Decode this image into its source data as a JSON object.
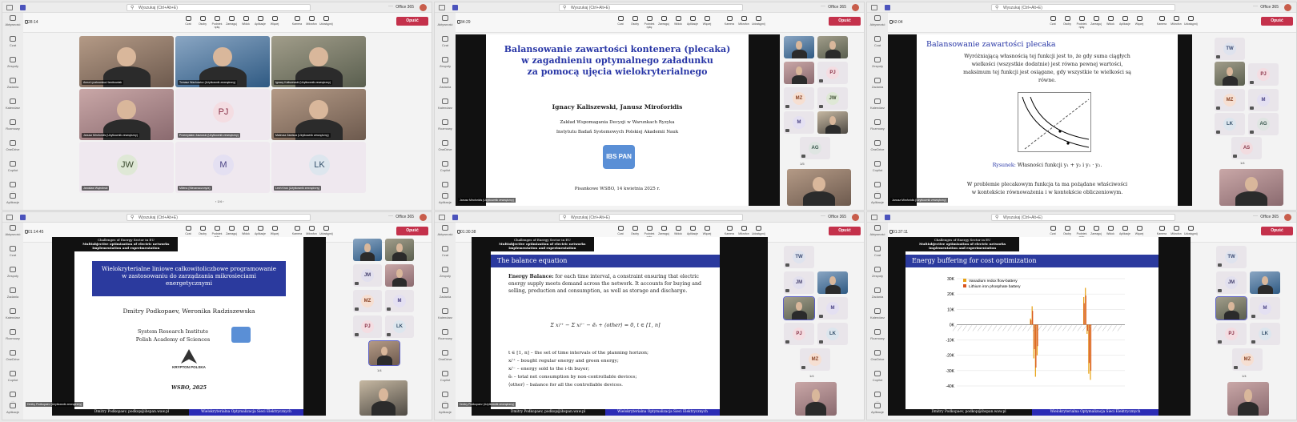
{
  "common": {
    "search_placeholder": "Wyszukaj (Ctrl+Alt+E)",
    "office_label": "Office 365",
    "rail": [
      "Aktywność",
      "Czat",
      "Zespoły",
      "Zadania",
      "Kalendarz",
      "Rozmowy",
      "OneDrive",
      "Copilot",
      "...",
      "Aplikacje"
    ],
    "controls": [
      "Czat",
      "Osoby",
      "Podnieś rękę",
      "Zareaguj",
      "Widok",
      "Aplikacje",
      "Więcej",
      "Kamera",
      "Mikrofon",
      "Udostępnij"
    ],
    "leave_label": "Opuść",
    "colors": {
      "leave": "#c4314b",
      "teams": "#4b53bc"
    }
  },
  "panels": [
    {
      "timer": "28:14",
      "tiles": [
        {
          "name": "Anna Łyczkowska-Hanćkowiak",
          "type": "video"
        },
        {
          "name": "Tomasz Wachowicz (Użytkownik zewnętrzny)",
          "type": "video"
        },
        {
          "name": "Ignacy Kaliszewski (Użytkownik zewnętrzny)",
          "type": "video"
        },
        {
          "name": "Janusz Miroforidis (Użytkownik zewnętrzny)",
          "type": "video"
        },
        {
          "name": "Przemysław Juszczuk (Użytkownik zewnętrzny)",
          "type": "avatar",
          "initials": "PJ"
        },
        {
          "name": "Mateusz Zawisza (Użytkownik zewnętrzny)",
          "type": "video"
        },
        {
          "name": "Jarosław Wątróbski",
          "type": "avatar",
          "initials": "JW"
        },
        {
          "name": "Milena (Nieoznaczony/a)",
          "type": "avatar",
          "initials": "M"
        },
        {
          "name": "Lech Kruś (Użytkownik zewnętrzny)",
          "type": "avatar",
          "initials": "LK"
        }
      ],
      "pager": "1/4"
    },
    {
      "timer": "34:29",
      "slide": {
        "title": [
          "Balansowanie zawartości kontenera (plecaka)",
          "w zagadnieniu optymalnego załadunku",
          "za pomocą ujęcia wielokryterialnego"
        ],
        "authors": "Ignacy Kaliszewski, Janusz Miroforidis",
        "affil1": "Zakład Wspomagania Decyzji w Warunkach Ryzyka",
        "affil2": "Instytutu Badań Systemowych Polskiej Akademii Nauk",
        "logo": "IBS PAN",
        "footer": "Pisankowe WSBO, 14 kwietnia 2025 r."
      },
      "presenter": "Janusz Miroforidis (Użytkownik zewnętrzny)",
      "side": [
        "PJ",
        "MZ",
        "JW",
        "M",
        "AG"
      ],
      "pager": "1/5"
    },
    {
      "timer": "42:04",
      "slide": {
        "title": "Balansowanie zawartości plecaka",
        "para": [
          "Wyróżniającą własnością tej funkcji jest to, że gdy suma ciągłych",
          "wielkości (wszystkie dodatnie) jest równa pewnej wartości,",
          "maksimum tej funkcji jest osiągane, gdy wszystkie te wielkości są",
          "równe."
        ],
        "caption_label": "Rysunek:",
        "caption": "Własności funkcji y₁ + y₂ i y₁ · y₂.",
        "bottom": [
          "W problemie plecakowym funkcja ta ma pożądane właściwości",
          "w kontekście równoważenia i w kontekście obliczeniowym."
        ]
      },
      "presenter": "Janusz Miroforidis (Użytkownik zewnętrzny)",
      "side": [
        "TW",
        "PJ",
        "MZ",
        "M",
        "LK",
        "AG",
        "AS"
      ],
      "pager": "1/4"
    },
    {
      "timer": "01:14:45",
      "slide": {
        "header1": "Challenges of Energy Sector in EU",
        "header2": "Multiobjective optimization of electric networks",
        "header3": "Implementation and experimentation",
        "title": [
          "Wielokryterialne liniowe całkowitoliczbowe programowanie",
          "w zastosowaniu do zarządzania mikrosieciami",
          "energetycznymi"
        ],
        "authors": "Dmitry Podkopaev, Weronika Radziszewska",
        "inst1": "System Research Institute",
        "inst2": "Polish Academy of Sciences",
        "logo2": "KRYPTON POLSKA",
        "event": "WSBO, 2025",
        "foot_left": "Dmitry Podkopaev, podkop@ibspan.waw.pl",
        "foot_right": "Wielokryterialna Optymalizacja Sieci Elektrycznych"
      },
      "presenter": "Dmitry Podkopaev (Użytkownik zewnętrzny)",
      "side": [
        "JM",
        "MZ",
        "M",
        "PJ",
        "LK"
      ],
      "pager": "1/4"
    },
    {
      "timer": "01:30:38",
      "slide": {
        "header1": "Challenges of Energy Sector in EU",
        "header2": "Multiobjective optimization of electric networks",
        "header3": "Implementation and experimentation",
        "title": "The balance equation",
        "lead": "Energy Balance:",
        "para": [
          "for each time interval, a constraint ensuring that",
          "electric energy supply meets demand across the network. It",
          "accounts for buying and selling, production and consumption, as",
          "well as storage and discharge."
        ],
        "equation": "Σ xᵢᵗ⁺ − Σ xᵢᵗ⁻ − ẽₜ + ⟨other⟩ = 0,    t ∈ [1, n]",
        "items": [
          "t ∈ [1, n] – the set of time intervals of the planning horizon;",
          "xᵢᵗ⁺ – bought regular energy and green energy;",
          "xᵢᵗ⁻ – energy sold to the i-th buyer;",
          "ẽₜ – total net consumption by non-controllable devices;",
          "⟨other⟩ – balance for all the controllable devices."
        ],
        "foot_left": "Dmitry Podkopaev, podkop@ibspan.waw.pl",
        "foot_right": "Wielokryterialna Optymalizacja Sieci Elektrycznych"
      },
      "presenter": "Dmitry Podkopaev (Użytkownik zewnętrzny)",
      "side": [
        "TW",
        "JM",
        "M",
        "PJ",
        "LK",
        "MZ"
      ],
      "pager": "1/4"
    },
    {
      "timer": "01:37:11",
      "slide": {
        "header1": "Challenges of Energy Sector in EU",
        "header2": "Multiobjective optimization of electric networks",
        "header3": "Implementation and experimentation",
        "title": "Energy buffering for cost optimization",
        "foot_left": "Dmitry Podkopaev, podkop@ibspan.waw.pl",
        "foot_right": "Wielokryterialna Optymalizacja Sieci Elektrycznych"
      },
      "chart_data": {
        "type": "bar",
        "series": [
          {
            "name": "Vanadium redox flow-battery",
            "color": "#e8a317"
          },
          {
            "name": "Lithium iron phosphate battery",
            "color": "#d9541e"
          }
        ],
        "yticks": [
          "30K",
          "20K",
          "10K",
          "0K",
          "-10K",
          "-20K",
          "-30K",
          "-40K"
        ],
        "ylim": [
          -40000,
          30000
        ],
        "values_vrfb": [
          0,
          0,
          0,
          0,
          0,
          0,
          0,
          0,
          0,
          0,
          0,
          0,
          0,
          0,
          0,
          0,
          0,
          0,
          0,
          0,
          0,
          0,
          0,
          0,
          0,
          0,
          0,
          0,
          0,
          0,
          0,
          0,
          0,
          0,
          0,
          0,
          0,
          0,
          0,
          0,
          0,
          0,
          0,
          0,
          4000,
          12000,
          -22000,
          -34000,
          -20000,
          0,
          0,
          0,
          0,
          0,
          0,
          0,
          0,
          0,
          0,
          0,
          0,
          0,
          0,
          0,
          0,
          0,
          0,
          0,
          0,
          0,
          0,
          0,
          0,
          0,
          0,
          0,
          18000,
          24000,
          -6000,
          -32000,
          -36000,
          0,
          0,
          0,
          0,
          0,
          0,
          0,
          0,
          0,
          0,
          0,
          0,
          0,
          0,
          0,
          0,
          0,
          0,
          0,
          0
        ],
        "values_lfp": [
          0,
          0,
          0,
          0,
          0,
          0,
          0,
          0,
          0,
          0,
          0,
          0,
          0,
          0,
          0,
          0,
          0,
          0,
          0,
          0,
          0,
          0,
          0,
          0,
          0,
          0,
          0,
          0,
          0,
          0,
          0,
          0,
          0,
          0,
          0,
          0,
          0,
          0,
          0,
          0,
          0,
          0,
          0,
          0,
          3000,
          9000,
          -16000,
          -28000,
          -14000,
          0,
          0,
          0,
          0,
          0,
          0,
          0,
          0,
          0,
          0,
          0,
          0,
          0,
          0,
          0,
          0,
          0,
          0,
          0,
          0,
          0,
          0,
          0,
          0,
          0,
          0,
          0,
          14000,
          19000,
          -4000,
          -25000,
          -30000,
          0,
          0,
          0,
          0,
          0,
          0,
          0,
          0,
          0,
          0,
          0,
          0,
          0,
          0,
          0,
          0,
          0,
          0,
          0,
          0
        ]
      },
      "side": [
        "TW",
        "JM",
        "M",
        "PJ",
        "LK",
        "MZ"
      ],
      "pager": "1/4"
    }
  ]
}
